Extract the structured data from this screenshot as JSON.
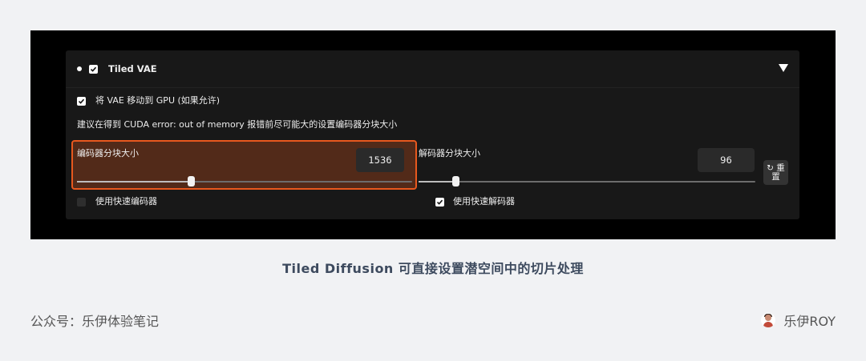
{
  "panel": {
    "title": "Tiled VAE",
    "title_checked": true,
    "move_to_gpu": {
      "label": "将 VAE 移动到 GPU (如果允许)",
      "checked": true
    },
    "hint": "建议在得到 CUDA error: out of memory 报错前尽可能大的设置编码器分块大小",
    "encoder_tile": {
      "label": "编码器分块大小",
      "value": "1536",
      "position": 0.34
    },
    "decoder_tile": {
      "label": "解码器分块大小",
      "value": "96",
      "position": 0.11
    },
    "reset_label": "↻ 重置",
    "fast_encoder": {
      "label": "使用快速编码器",
      "checked": false
    },
    "fast_decoder": {
      "label": "使用快速解码器",
      "checked": true
    },
    "highlight_color": "#e8581e"
  },
  "caption": "Tiled Diffusion 可直接设置潜空间中的切片处理",
  "footer": {
    "left": "公众号：乐伊体验笔记",
    "right": "乐伊ROY"
  }
}
